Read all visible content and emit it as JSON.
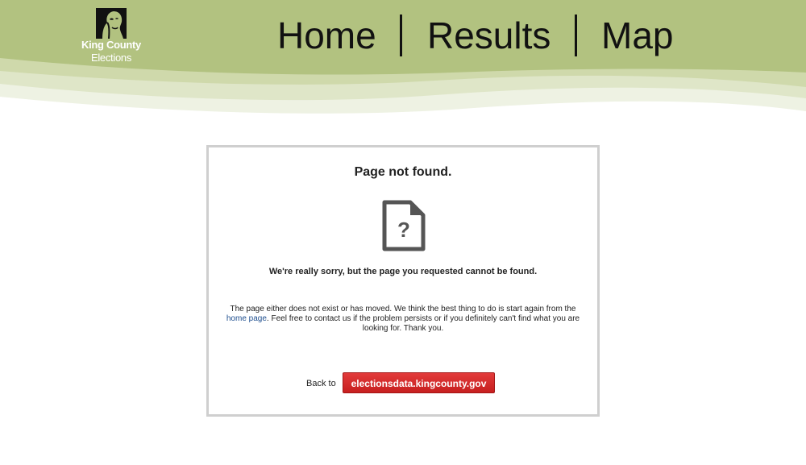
{
  "header": {
    "logo": {
      "icon": "king-county-portrait-icon",
      "name": "King County",
      "sub": "Elections"
    },
    "nav": [
      {
        "label": "Home"
      },
      {
        "label": "Results"
      },
      {
        "label": "Map"
      }
    ],
    "colors": {
      "band": "#b2c280",
      "wave_light": "#cfd9ab",
      "wave_lighter": "#e5ebd3"
    }
  },
  "error": {
    "title": "Page not found.",
    "icon": "file-question-icon",
    "apology": "We're really sorry, but the page you requested cannot be found.",
    "explain_before": "The page either does not exist or has moved. We think the best thing to do is start again from the",
    "explain_link": "home page",
    "explain_after": ". Feel free to contact us if the problem persists or if you definitely can't find what you are looking for. Thank you.",
    "back_label": "Back to",
    "back_button": "electionsdata.kingcounty.gov"
  },
  "colors": {
    "button": "#d32a2a",
    "link": "#1f4f8f",
    "panel_border": "#cfcfcf"
  }
}
